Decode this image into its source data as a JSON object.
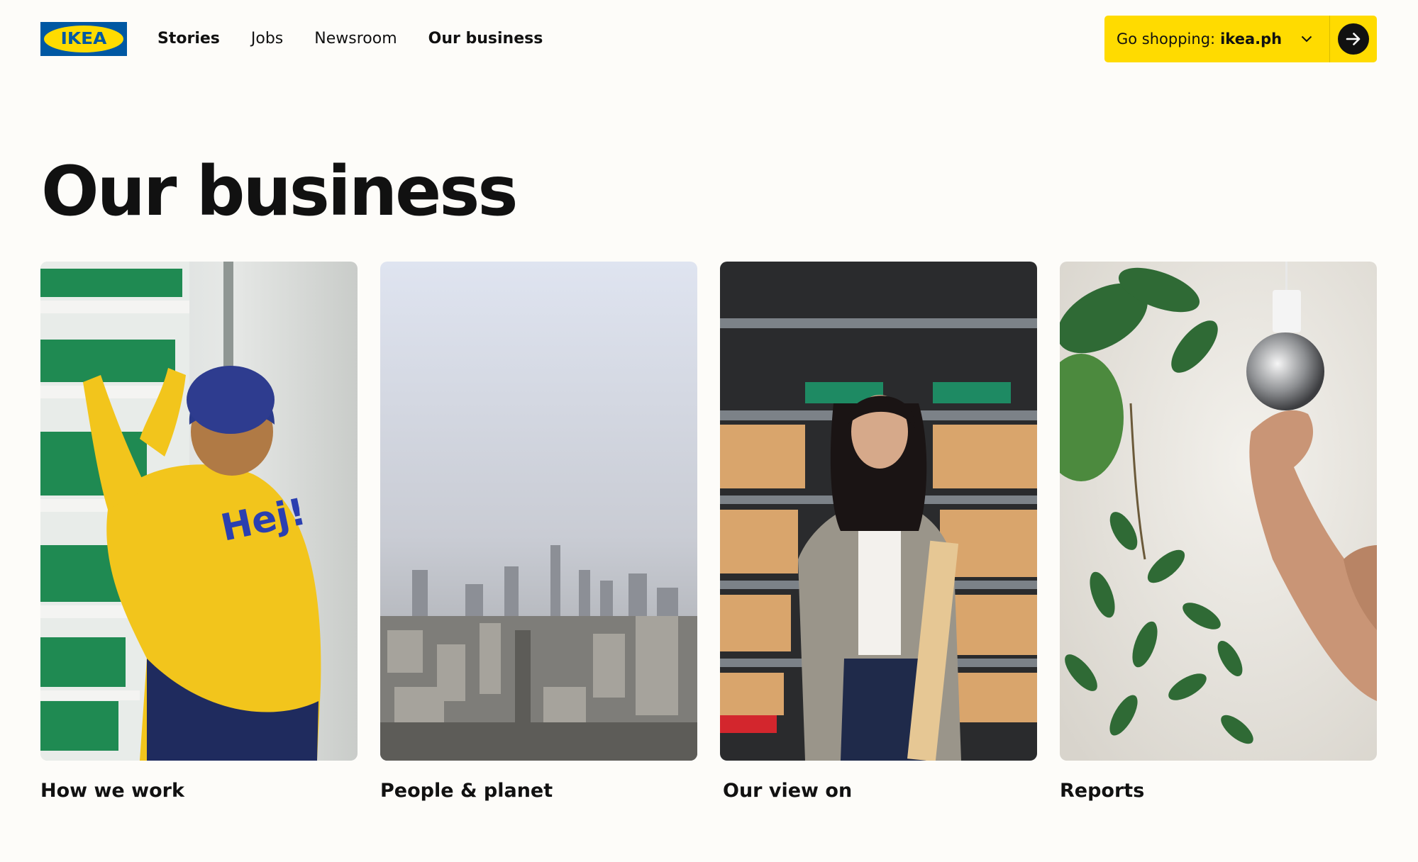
{
  "brand": {
    "logo_text": "IKEA"
  },
  "nav": {
    "items": [
      {
        "label": "Stories"
      },
      {
        "label": "Jobs"
      },
      {
        "label": "Newsroom"
      },
      {
        "label": "Our business"
      }
    ]
  },
  "shop_selector": {
    "label": "Go shopping:",
    "site": "ikea.ph",
    "chevron_icon": "chevron-down-icon",
    "go_icon": "arrow-right-icon"
  },
  "page": {
    "title": "Our business"
  },
  "cards": [
    {
      "label": "How we work",
      "image_text": "Hej!"
    },
    {
      "label": "People & planet"
    },
    {
      "label": "Our view on"
    },
    {
      "label": "Reports"
    }
  ],
  "colors": {
    "brand_blue": "#0058a3",
    "brand_yellow": "#ffdb00",
    "background": "#fdfcf9",
    "text": "#111111"
  }
}
